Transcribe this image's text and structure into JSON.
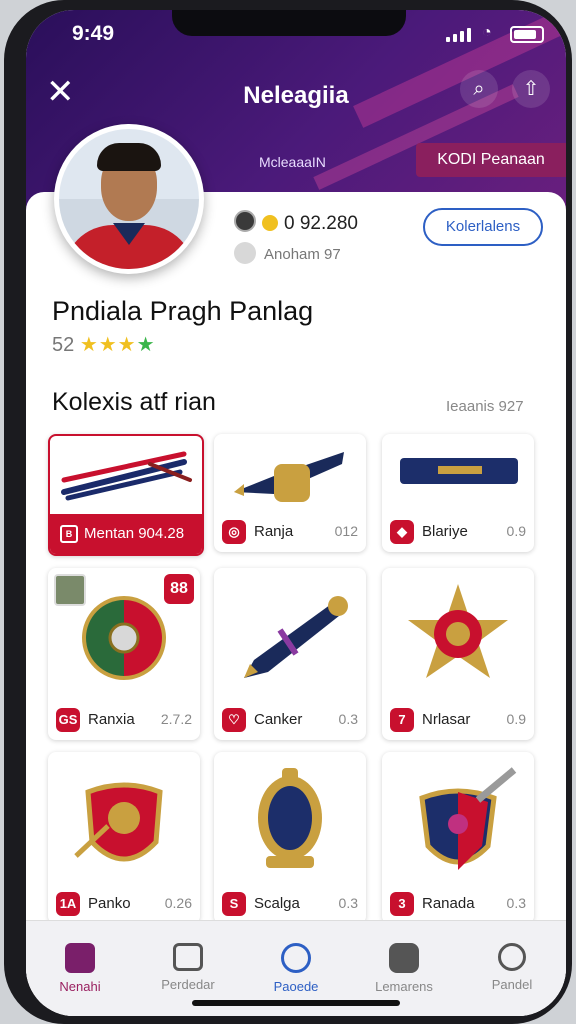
{
  "status_bar": {
    "time": "9:49"
  },
  "header": {
    "title": "Neleagiia",
    "mid_label": "McleaaaIN",
    "promo_label": "KODI Peanaan"
  },
  "profile": {
    "coins": "0 92.280",
    "sublabel": "Anoham 97",
    "action_button": "Kolerlalens",
    "name": "Pndiala Pragh Panlag",
    "rating_value": "52",
    "stars_shown": 4
  },
  "collection": {
    "title": "Kolexis atf rian",
    "count_label": "Ieaanis 927",
    "items": [
      {
        "label": "Mentan  904.28",
        "value": "",
        "icon": "B",
        "badge": ""
      },
      {
        "label": "Ranja",
        "value": "012",
        "icon": "◎",
        "badge": ""
      },
      {
        "label": "Blariye",
        "value": "0.9",
        "icon": "◆",
        "badge": ""
      },
      {
        "label": "Ranxia",
        "value": "2.7.2",
        "icon": "GS",
        "badge": "88"
      },
      {
        "label": "Canker",
        "value": "0.3",
        "icon": "♡",
        "badge": ""
      },
      {
        "label": "Nrlasar",
        "value": "0.9",
        "icon": "7",
        "badge": ""
      },
      {
        "label": "Panko",
        "value": "0.26",
        "icon": "1A",
        "badge": ""
      },
      {
        "label": "Scalga",
        "value": "0.3",
        "icon": "S",
        "badge": ""
      },
      {
        "label": "Ranada",
        "value": "0.3",
        "icon": "3",
        "badge": ""
      }
    ]
  },
  "bottom_nav": [
    {
      "label": "Nenahi",
      "icon": "home-icon"
    },
    {
      "label": "Perdedar",
      "icon": "card-icon"
    },
    {
      "label": "Paoede",
      "icon": "shield-icon"
    },
    {
      "label": "Lemarens",
      "icon": "gem-icon"
    },
    {
      "label": "Pandel",
      "icon": "profile-icon"
    }
  ],
  "colors": {
    "accent": "#c8102e",
    "header": "#3a1568",
    "link": "#2d5fc4"
  }
}
